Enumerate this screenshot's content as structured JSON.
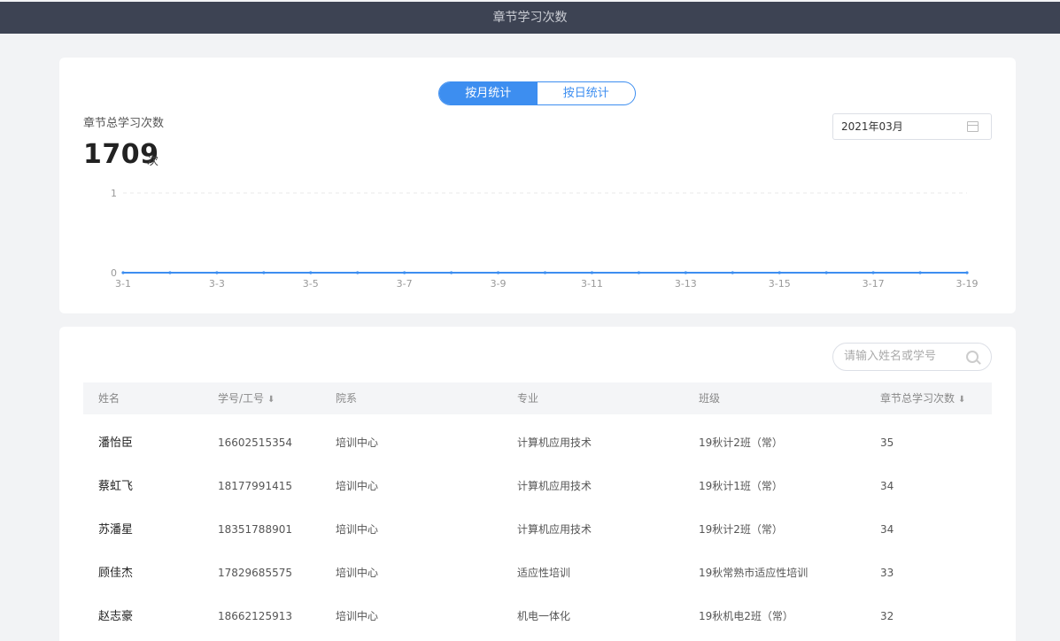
{
  "header": {
    "title": "章节学习次数"
  },
  "toggle": {
    "month_label": "按月统计",
    "day_label": "按日统计"
  },
  "summary": {
    "label": "章节总学习次数",
    "value": "1709",
    "unit": "次"
  },
  "date_picker": {
    "value": "2021年03月",
    "icon": "calendar-icon"
  },
  "chart_data": {
    "type": "line",
    "x": [
      "3-1",
      "3-2",
      "3-3",
      "3-4",
      "3-5",
      "3-6",
      "3-7",
      "3-8",
      "3-9",
      "3-10",
      "3-11",
      "3-12",
      "3-13",
      "3-14",
      "3-15",
      "3-16",
      "3-17",
      "3-18",
      "3-19"
    ],
    "x_tick_labels": [
      "3-1",
      "3-3",
      "3-5",
      "3-7",
      "3-9",
      "3-11",
      "3-13",
      "3-15",
      "3-17",
      "3-19"
    ],
    "series": [
      {
        "values": [
          0,
          0,
          0,
          0,
          0,
          0,
          0,
          0,
          0,
          0,
          0,
          0,
          0,
          0,
          0,
          0,
          0,
          0,
          0
        ]
      }
    ],
    "y_tick_labels": [
      "0",
      "1"
    ],
    "ylim": [
      0,
      1
    ],
    "grid": true,
    "color": "#3d8ef0"
  },
  "search": {
    "placeholder": "请输入姓名或学号",
    "icon": "search-icon"
  },
  "table": {
    "columns": [
      "姓名",
      "学号/工号",
      "院系",
      "专业",
      "班级",
      "章节总学习次数"
    ],
    "rows": [
      [
        "潘怡臣",
        "16602515354",
        "培训中心",
        "计算机应用技术",
        "19秋计2班（常）",
        "35"
      ],
      [
        "蔡虹飞",
        "18177991415",
        "培训中心",
        "计算机应用技术",
        "19秋计1班（常）",
        "34"
      ],
      [
        "苏潘星",
        "18351788901",
        "培训中心",
        "计算机应用技术",
        "19秋计2班（常）",
        "34"
      ],
      [
        "顾佳杰",
        "17829685575",
        "培训中心",
        "适应性培训",
        "19秋常熟市适应性培训",
        "33"
      ],
      [
        "赵志豪",
        "18662125913",
        "培训中心",
        "机电一体化",
        "19秋机电2班（常）",
        "32"
      ]
    ]
  }
}
